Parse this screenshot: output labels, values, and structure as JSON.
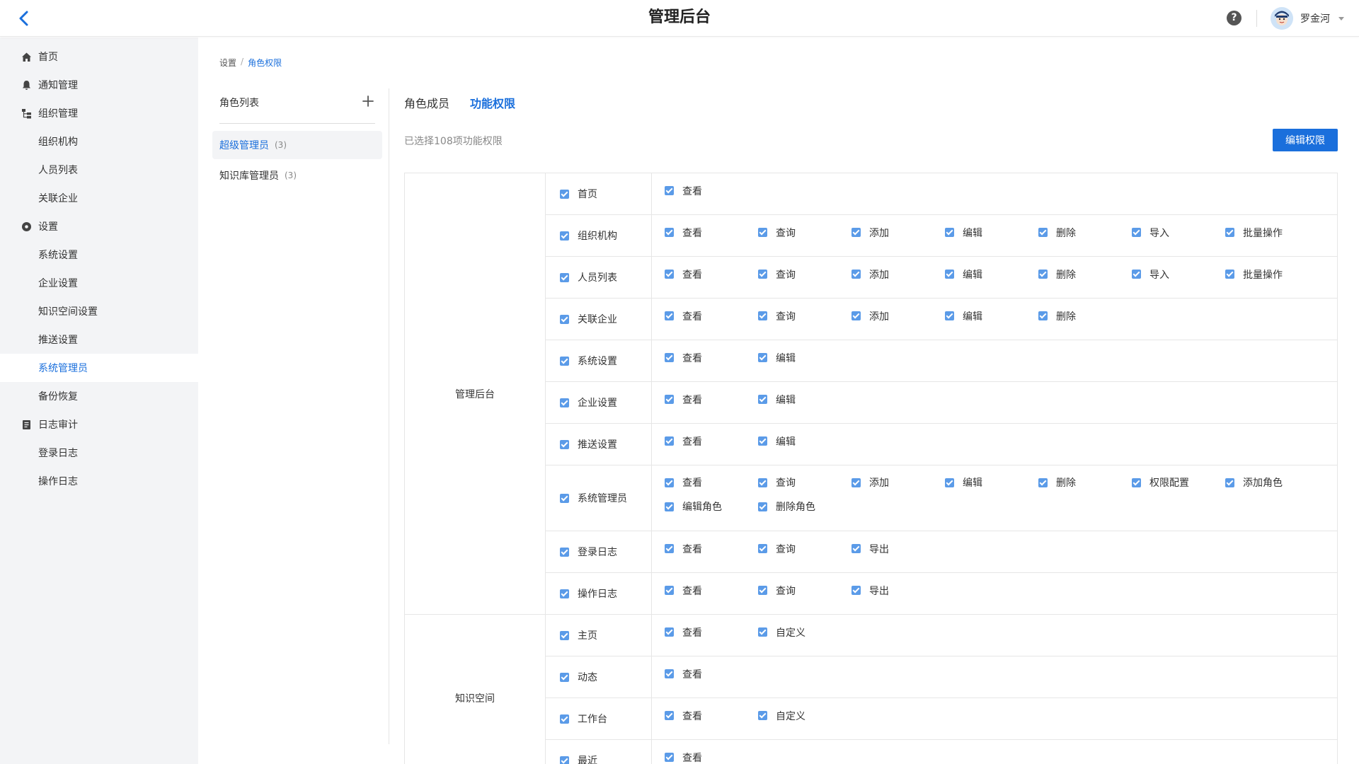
{
  "header": {
    "title": "管理后台",
    "user_name": "罗金河",
    "help": "?"
  },
  "sidebar": {
    "items": [
      {
        "label": "首页",
        "icon": "home-icon",
        "top": 0
      },
      {
        "label": "通知管理",
        "icon": "bell-icon"
      },
      {
        "label": "组织管理",
        "icon": "org-tree-icon"
      },
      {
        "label": "组织机构"
      },
      {
        "label": "人员列表"
      },
      {
        "label": "关联企业"
      },
      {
        "label": "设置",
        "icon": "gear-icon"
      },
      {
        "label": "系统设置"
      },
      {
        "label": "企业设置"
      },
      {
        "label": "知识空间设置"
      },
      {
        "label": "推送设置"
      },
      {
        "label": "系统管理员",
        "active": true
      },
      {
        "label": "备份恢复"
      },
      {
        "label": "日志审计",
        "icon": "log-icon"
      },
      {
        "label": "登录日志"
      },
      {
        "label": "操作日志"
      }
    ]
  },
  "breadcrumb": {
    "parent": "设置",
    "sep": "/",
    "current": "角色权限"
  },
  "roles": {
    "title": "角色列表",
    "items": [
      {
        "name": "超级管理员",
        "count": "(3)",
        "active": true
      },
      {
        "name": "知识库管理员",
        "count": "(3)"
      }
    ]
  },
  "tabs": [
    {
      "label": "角色成员"
    },
    {
      "label": "功能权限",
      "active": true
    }
  ],
  "selection_info": "已选择108项功能权限",
  "edit_button": "编辑权限",
  "colors": {
    "accent": "#1a6fdc",
    "checkbox": "#5b9be8"
  },
  "groups": [
    {
      "name": "管理后台",
      "rows": [
        {
          "name": "首页",
          "actions": [
            "查看"
          ]
        },
        {
          "name": "组织机构",
          "actions": [
            "查看",
            "查询",
            "添加",
            "编辑",
            "删除",
            "导入",
            "批量操作"
          ]
        },
        {
          "name": "人员列表",
          "actions": [
            "查看",
            "查询",
            "添加",
            "编辑",
            "删除",
            "导入",
            "批量操作"
          ]
        },
        {
          "name": "关联企业",
          "actions": [
            "查看",
            "查询",
            "添加",
            "编辑",
            "删除"
          ]
        },
        {
          "name": "系统设置",
          "actions": [
            "查看",
            "编辑"
          ]
        },
        {
          "name": "企业设置",
          "actions": [
            "查看",
            "编辑"
          ]
        },
        {
          "name": "推送设置",
          "actions": [
            "查看",
            "编辑"
          ]
        },
        {
          "name": "系统管理员",
          "actions": [
            "查看",
            "查询",
            "添加",
            "编辑",
            "删除",
            "权限配置",
            "添加角色",
            "编辑角色",
            "删除角色"
          ]
        },
        {
          "name": "登录日志",
          "actions": [
            "查看",
            "查询",
            "导出"
          ]
        },
        {
          "name": "操作日志",
          "actions": [
            "查看",
            "查询",
            "导出"
          ]
        }
      ]
    },
    {
      "name": "知识空间",
      "rows": [
        {
          "name": "主页",
          "actions": [
            "查看",
            "自定义"
          ]
        },
        {
          "name": "动态",
          "actions": [
            "查看"
          ]
        },
        {
          "name": "工作台",
          "actions": [
            "查看",
            "自定义"
          ]
        },
        {
          "name": "最近",
          "actions": [
            "查看"
          ]
        }
      ]
    }
  ]
}
